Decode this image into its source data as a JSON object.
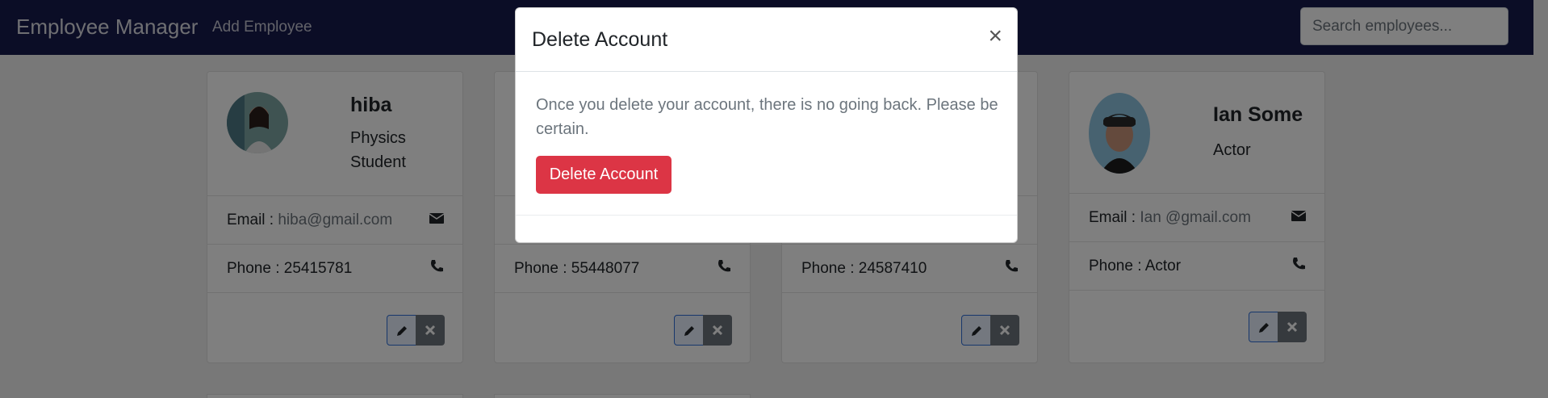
{
  "navbar": {
    "brand": "Employee Manager",
    "add_link": "Add Employee",
    "search_placeholder": "Search employees..."
  },
  "cards": [
    {
      "name": "hiba",
      "job": "Physics Student",
      "email_label": "Email : ",
      "email": "hiba@gmail.com",
      "phone_label": "Phone : ",
      "phone": "25415781"
    },
    {
      "phone_label": "Phone : ",
      "phone": "55448077"
    },
    {
      "phone_label": "Phone : ",
      "phone": "24587410"
    },
    {
      "name": "Ian Some",
      "job": "Actor",
      "email_label": "Email : ",
      "email": "Ian @gmail.com",
      "phone_label": "Phone : ",
      "phone": "Actor"
    }
  ],
  "modal": {
    "title": "Delete Account",
    "close": "×",
    "message": "Once you delete your account, there is no going back. Please be certain.",
    "button": "Delete Account"
  },
  "colors": {
    "navbar": "#161a4d",
    "danger": "#dc3545",
    "edit_border": "#2e6fd8"
  },
  "icons": [
    "envelope-icon",
    "phone-icon",
    "pencil-icon",
    "x-icon",
    "close-icon"
  ]
}
